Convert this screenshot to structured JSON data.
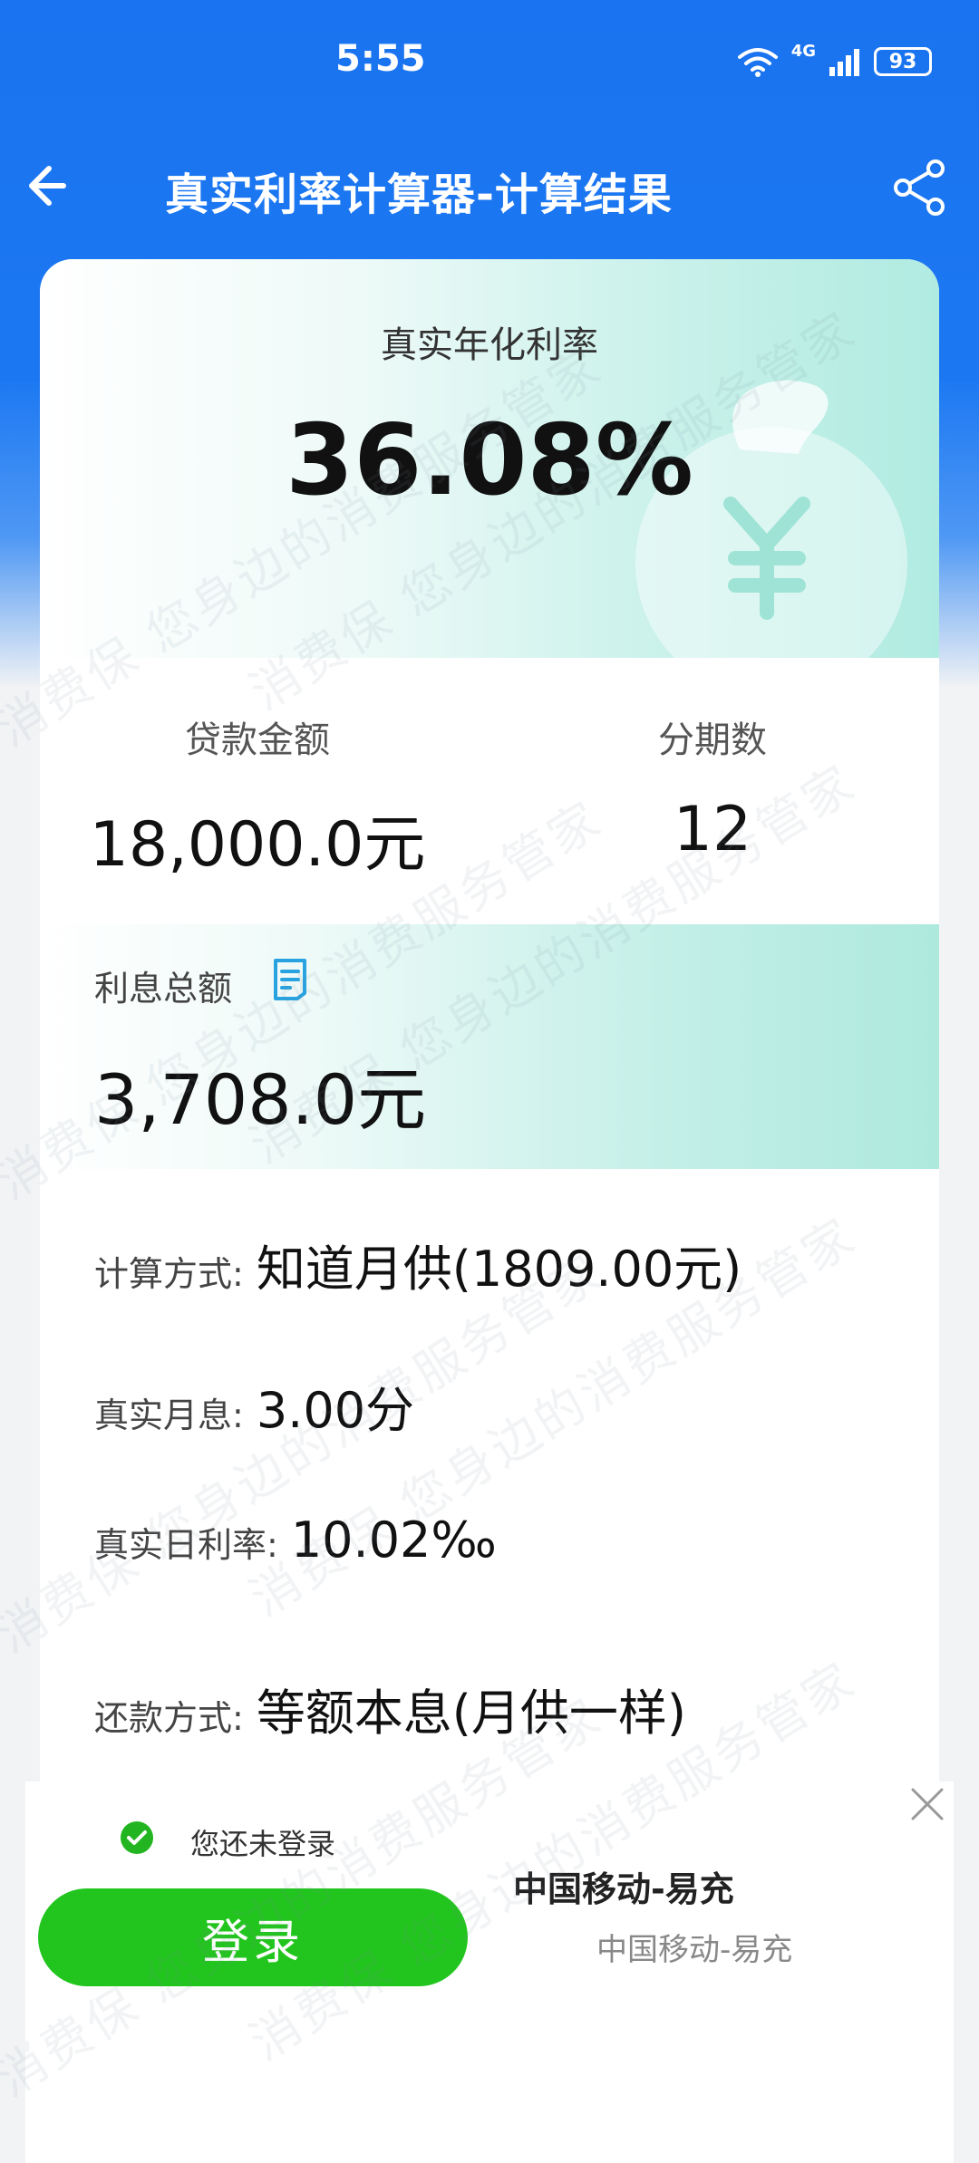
{
  "status_bar": {
    "time": "5:55",
    "battery": "93",
    "network": "4G"
  },
  "header": {
    "title": "真实利率计算器-计算结果"
  },
  "hero": {
    "label": "真实年化利率",
    "value": "36.08%"
  },
  "stats": [
    {
      "label": "贷款金额",
      "value": "18,000.0元"
    },
    {
      "label": "分期数",
      "value": "12"
    }
  ],
  "interest": {
    "label": "利息总额",
    "value": "3,708.0元"
  },
  "details": [
    {
      "key": "计算方式:",
      "value": "知道月供(1809.00元)"
    },
    {
      "key": "真实月息:",
      "value": "3.00分"
    },
    {
      "key": "真实日利率:",
      "value": "10.02‰"
    },
    {
      "key": "还款方式:",
      "value": "等额本息(月供一样)"
    }
  ],
  "login_panel": {
    "tip": "您还未登录",
    "button_label": "登录",
    "app_name": "中国移动-易充",
    "app_subtitle": "中国移动-易充"
  },
  "watermark": "消费保 您身边的消费服务管家",
  "colors": {
    "brand_blue": "#1a73f0",
    "login_green": "#22c51e",
    "teal": "#b0ebe1"
  }
}
